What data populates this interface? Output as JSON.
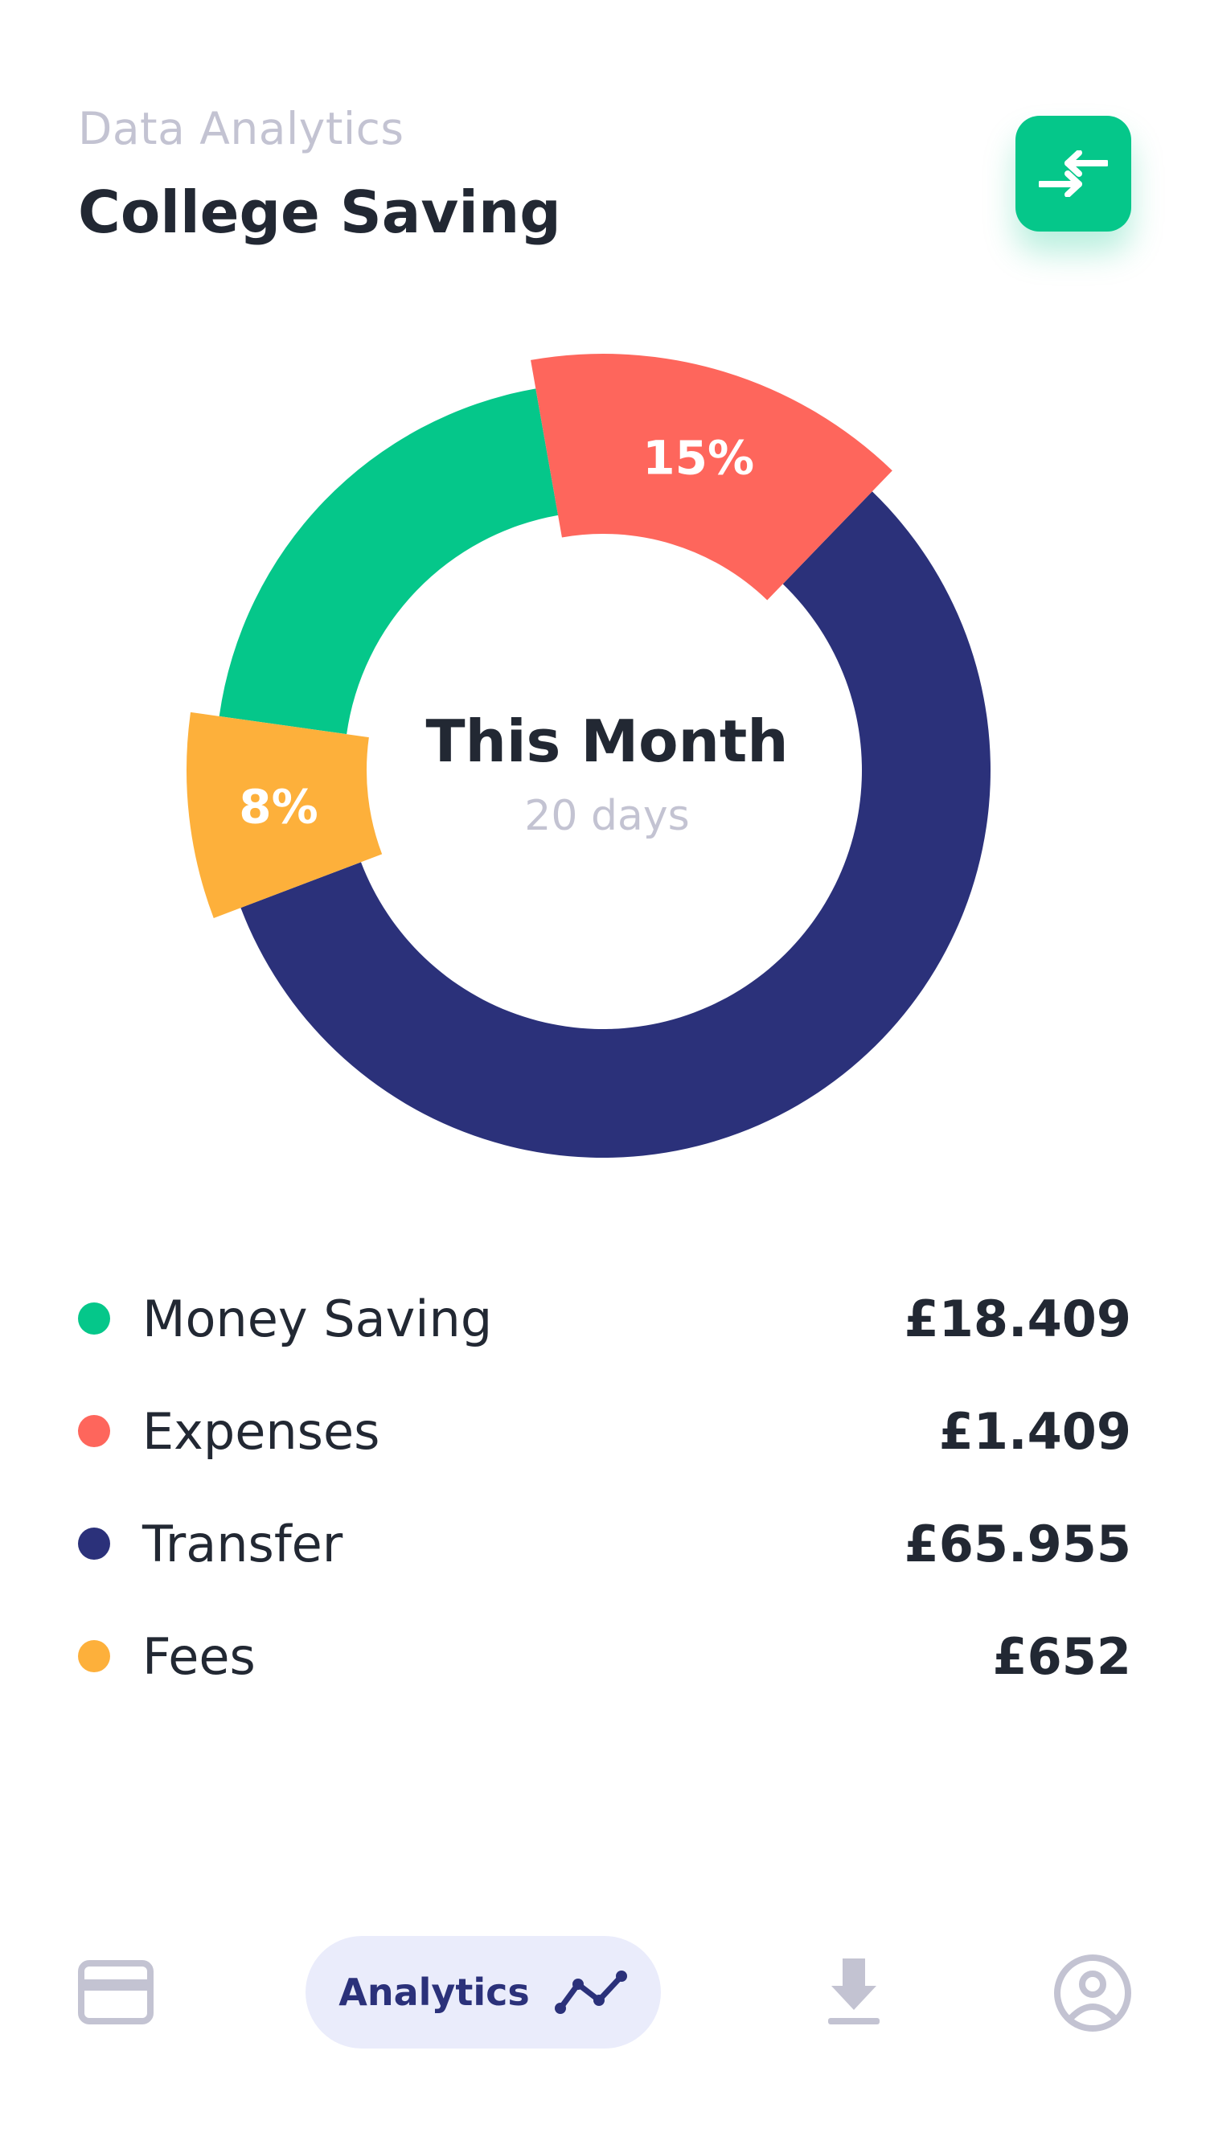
{
  "header": {
    "subtitle": "Data Analytics",
    "title": "College Saving",
    "action_icon": "swap-arrows-icon"
  },
  "colors": {
    "money_saving": "#05c78a",
    "expenses": "#fe665c",
    "transfer": "#2b317a",
    "fees": "#fdb03b",
    "accent": "#05c78a",
    "nav_active_bg": "#eaecfb",
    "muted": "#c3c3d2"
  },
  "donut": {
    "center_title": "This Month",
    "center_subtitle": "20 days",
    "expenses_label": "15%",
    "fees_label": "8%"
  },
  "chart_data": {
    "type": "pie",
    "segments": [
      {
        "name": "Money Saving",
        "percent": 20,
        "color": "#05c78a"
      },
      {
        "name": "Expenses",
        "percent": 15,
        "color": "#fe665c",
        "label": "15%"
      },
      {
        "name": "Transfer",
        "percent": 57,
        "color": "#2b317a"
      },
      {
        "name": "Fees",
        "percent": 8,
        "color": "#fdb03b",
        "label": "8%"
      }
    ]
  },
  "legend": {
    "items": [
      {
        "label": "Money Saving",
        "value": "£18.409",
        "color": "#05c78a"
      },
      {
        "label": "Expenses",
        "value": "£1.409",
        "color": "#fe665c"
      },
      {
        "label": "Transfer",
        "value": "£65.955",
        "color": "#2b317a"
      },
      {
        "label": "Fees",
        "value": "£652",
        "color": "#fdb03b"
      }
    ]
  },
  "bottom_nav": {
    "card_icon": "credit-card-icon",
    "analytics_label": "Analytics",
    "analytics_icon": "trend-line-icon",
    "download_icon": "download-icon",
    "profile_icon": "user-circle-icon"
  }
}
